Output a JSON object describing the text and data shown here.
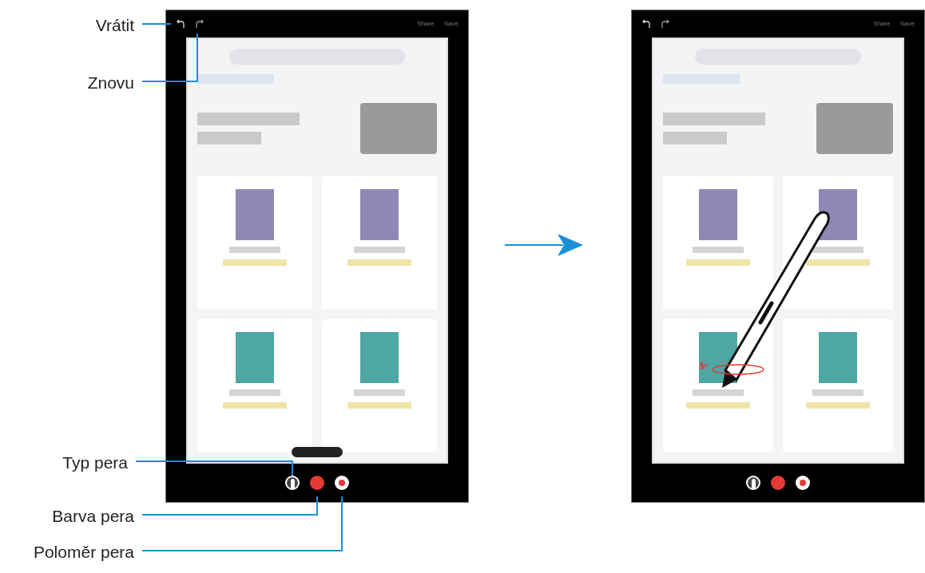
{
  "callouts": [
    {
      "label": "Vrátit"
    },
    {
      "label": "Znovu"
    },
    {
      "label": "Typ pera"
    },
    {
      "label": "Barva pera"
    },
    {
      "label": "Poloměr pera"
    }
  ],
  "tablets": [
    {
      "kind": "plain",
      "actions": [
        "Share",
        "Save"
      ]
    },
    {
      "kind": "annotated",
      "actions": [
        "Share",
        "Save"
      ]
    }
  ]
}
